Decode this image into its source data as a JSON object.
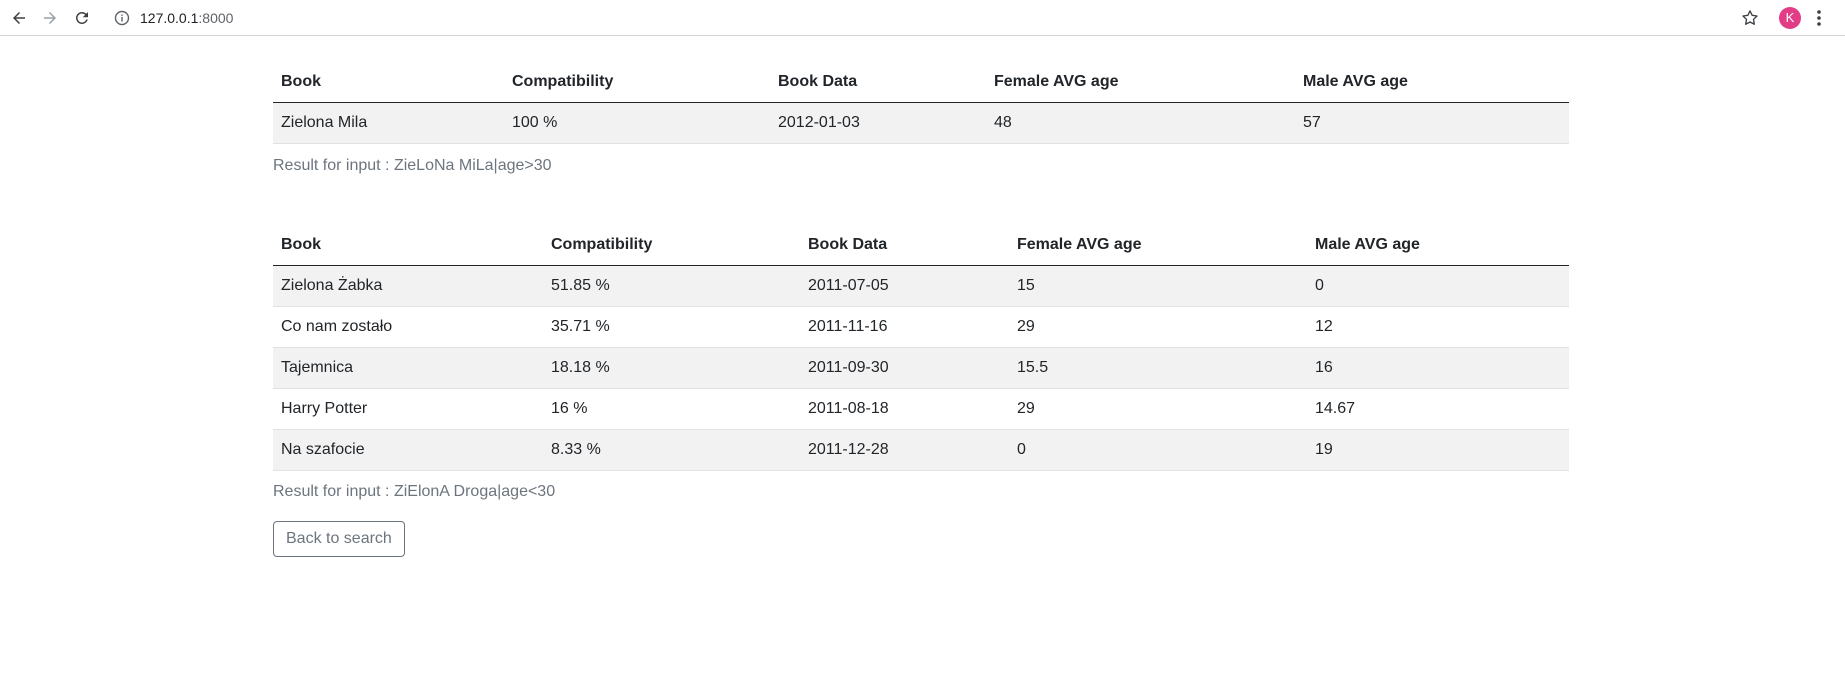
{
  "browser": {
    "url_host": "127.0.0.1",
    "url_port": ":8000",
    "profile_initial": "K",
    "icons": [
      "back-arrow-icon",
      "forward-arrow-icon",
      "reload-icon",
      "info-icon",
      "star-icon",
      "kebab-menu-icon"
    ],
    "avatar_color": "#e33c86"
  },
  "tables": [
    {
      "headers": [
        "Book",
        "Compatibility",
        "Book Data",
        "Female AVG age",
        "Male AVG age"
      ],
      "rows": [
        [
          "Zielona Mila",
          "100 %",
          "2012-01-03",
          "48",
          "57"
        ]
      ],
      "caption": "Result for input : ZieLoNa MiLa|age>30"
    },
    {
      "headers": [
        "Book",
        "Compatibility",
        "Book Data",
        "Female AVG age",
        "Male AVG age"
      ],
      "rows": [
        [
          "Zielona Żabka",
          "51.85 %",
          "2011-07-05",
          "15",
          "0"
        ],
        [
          "Co nam zostało",
          "35.71 %",
          "2011-11-16",
          "29",
          "12"
        ],
        [
          "Tajemnica",
          "18.18 %",
          "2011-09-30",
          "15.5",
          "16"
        ],
        [
          "Harry Potter",
          "16 %",
          "2011-08-18",
          "29",
          "14.67"
        ],
        [
          "Na szafocie",
          "8.33 %",
          "2011-12-28",
          "0",
          "19"
        ]
      ],
      "caption": "Result for input : ZiElonA Droga|age<30"
    }
  ],
  "back_button_label": "Back to search"
}
